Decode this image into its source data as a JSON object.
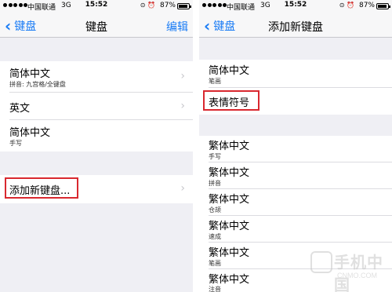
{
  "status_bar": {
    "carrier": "中国联通",
    "network": "3G",
    "time": "15:52",
    "battery": "87%"
  },
  "left": {
    "nav": {
      "back": "键盘",
      "title": "键盘",
      "edit": "编辑"
    },
    "keyboards": [
      {
        "title": "简体中文",
        "subtitle": "拼音: 九宫格/全键盘"
      },
      {
        "title": "英文",
        "subtitle": ""
      },
      {
        "title": "简体中文",
        "subtitle": "手写"
      }
    ],
    "add_keyboard": "添加新键盘..."
  },
  "right": {
    "nav": {
      "back": "键盘",
      "title": "添加新键盘"
    },
    "top_items": [
      {
        "title": "简体中文",
        "subtitle": "笔画"
      },
      {
        "title": "表情符号",
        "subtitle": ""
      }
    ],
    "items": [
      {
        "title": "繁体中文",
        "subtitle": "手写"
      },
      {
        "title": "繁体中文",
        "subtitle": "拼音"
      },
      {
        "title": "繁体中文",
        "subtitle": "仓颉"
      },
      {
        "title": "繁体中文",
        "subtitle": "速成"
      },
      {
        "title": "繁体中文",
        "subtitle": "笔画"
      },
      {
        "title": "繁体中文",
        "subtitle": "注音"
      }
    ]
  },
  "watermark": {
    "text": "手机中国",
    "url": "CNMO.COM"
  },
  "colors": {
    "accent": "#1a7cf5",
    "highlight": "#d9282f",
    "background": "#efeff4"
  }
}
